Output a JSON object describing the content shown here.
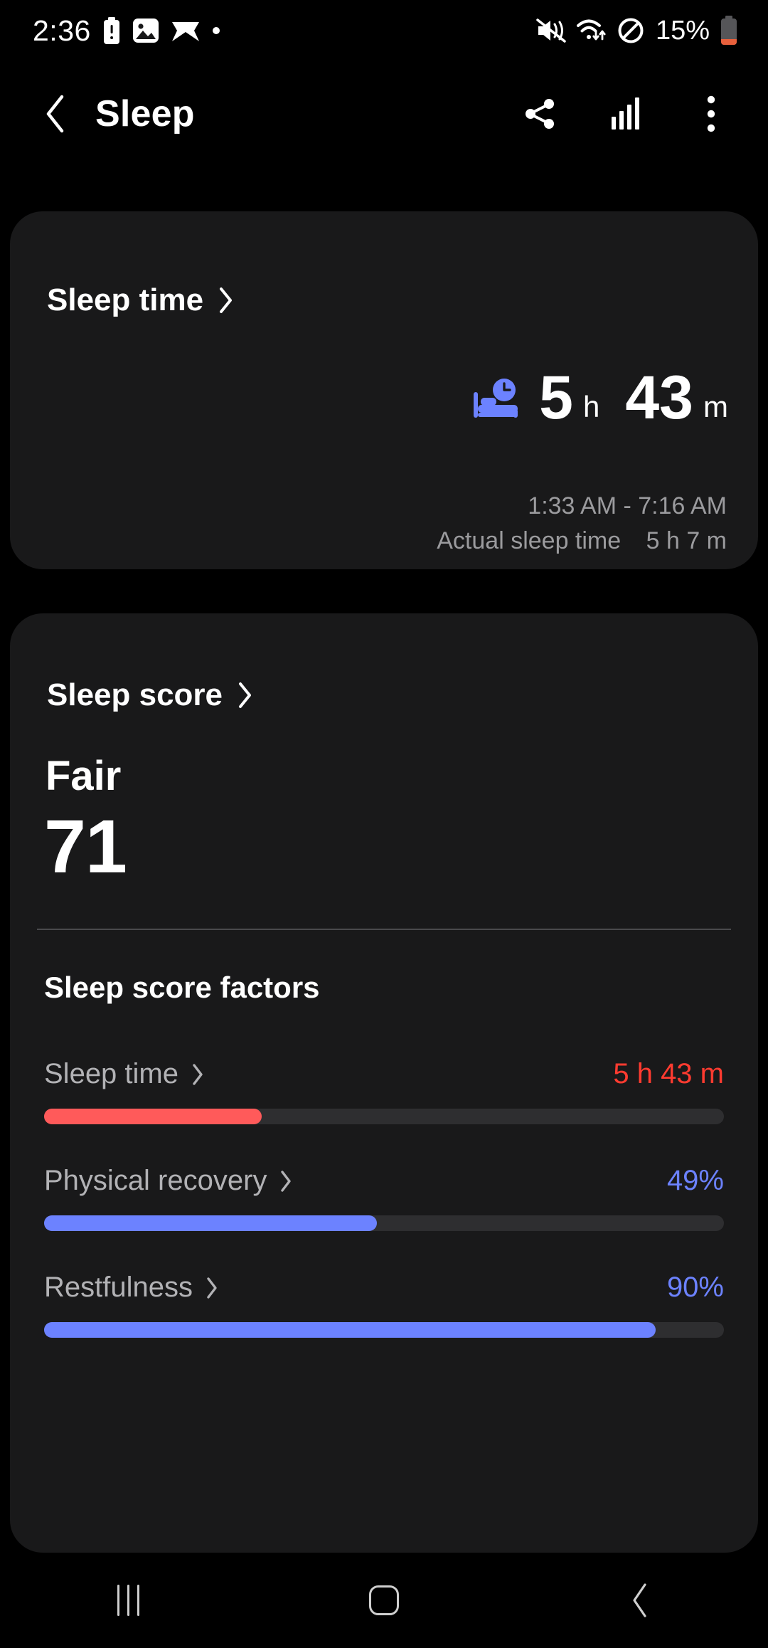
{
  "status_bar": {
    "time": "2:36",
    "battery_percent": "15%",
    "left_icons": [
      "battery-alert-icon",
      "image-icon",
      "app-icon"
    ],
    "right_icons": [
      "mute-vibrate-icon",
      "wifi-icon",
      "do-not-disturb-icon",
      "battery-low-icon"
    ]
  },
  "app_bar": {
    "back_icon": "chevron-left-icon",
    "title": "Sleep",
    "share_icon": "share-icon",
    "chart_icon": "bar-chart-icon",
    "more_icon": "overflow-menu-icon"
  },
  "sleep_time_card": {
    "header": "Sleep time",
    "chevron": "chevron-right-icon",
    "bed_icon": "bed-clock-icon",
    "hours": "5",
    "hours_unit": "h",
    "minutes": "43",
    "minutes_unit": "m",
    "range": "1:33 AM - 7:16 AM",
    "actual_label": "Actual sleep time",
    "actual_value": "5 h 7 m"
  },
  "sleep_score_card": {
    "header": "Sleep score",
    "chevron": "chevron-right-icon",
    "grade": "Fair",
    "score": "71",
    "factors_title": "Sleep score factors",
    "factors": [
      {
        "label": "Sleep time",
        "value": "5 h 43 m",
        "percent": 32,
        "color": "#FF5A5A",
        "value_color": "#FF3B30"
      },
      {
        "label": "Physical recovery",
        "value": "49%",
        "percent": 49,
        "color": "#6C82FF",
        "value_color": "#6C82FF"
      },
      {
        "label": "Restfulness",
        "value": "90%",
        "percent": 90,
        "color": "#6C82FF",
        "value_color": "#6C82FF"
      }
    ]
  },
  "nav_bar": {
    "recents_label": "recents-button",
    "home_label": "home-button",
    "back_label": "back-button"
  },
  "colors": {
    "page_bg": "#000000",
    "card_bg": "#19191A",
    "accent_blue": "#6C82FF",
    "accent_red": "#FF5A5A",
    "track": "#2E2E30",
    "muted_text": "#9B9B9E"
  },
  "chart_data": {
    "type": "bar",
    "title": "Sleep score factors",
    "categories": [
      "Sleep time",
      "Physical recovery",
      "Restfulness"
    ],
    "values": [
      32,
      49,
      90
    ],
    "value_labels": [
      "5 h 43 m",
      "49%",
      "90%"
    ],
    "xlabel": "",
    "ylabel": "",
    "ylim": [
      0,
      100
    ],
    "grid": false,
    "legend": "none",
    "orientation": "horizontal",
    "series_colors": [
      "#FF5A5A",
      "#6C82FF",
      "#6C82FF"
    ]
  }
}
